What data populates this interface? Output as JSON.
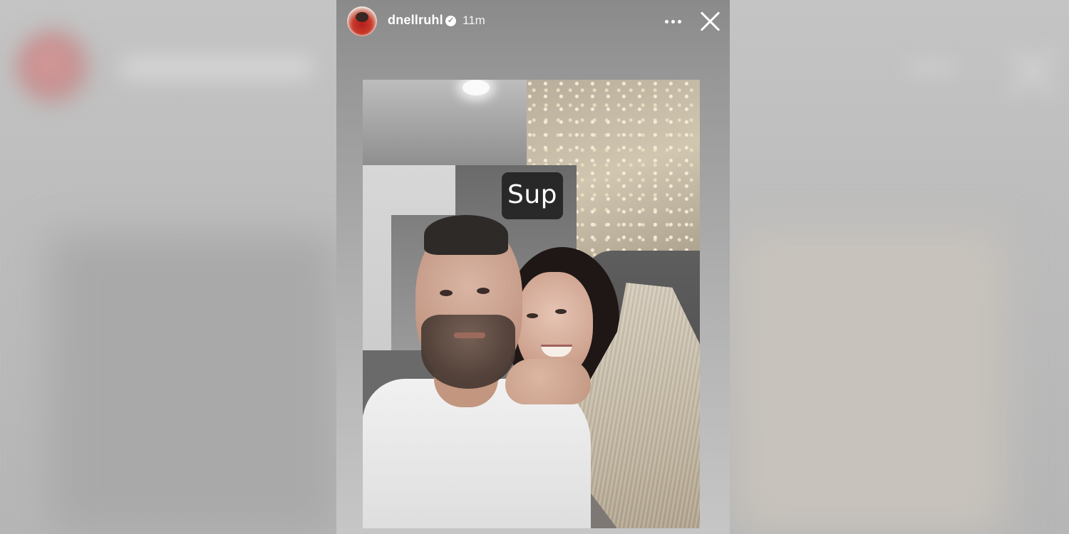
{
  "story": {
    "username": "dnellruhl",
    "verified_icon": "verified-badge-icon",
    "timestamp": "11m",
    "more_icon": "more-options-icon",
    "close_icon": "close-icon",
    "caption": "Sup"
  }
}
